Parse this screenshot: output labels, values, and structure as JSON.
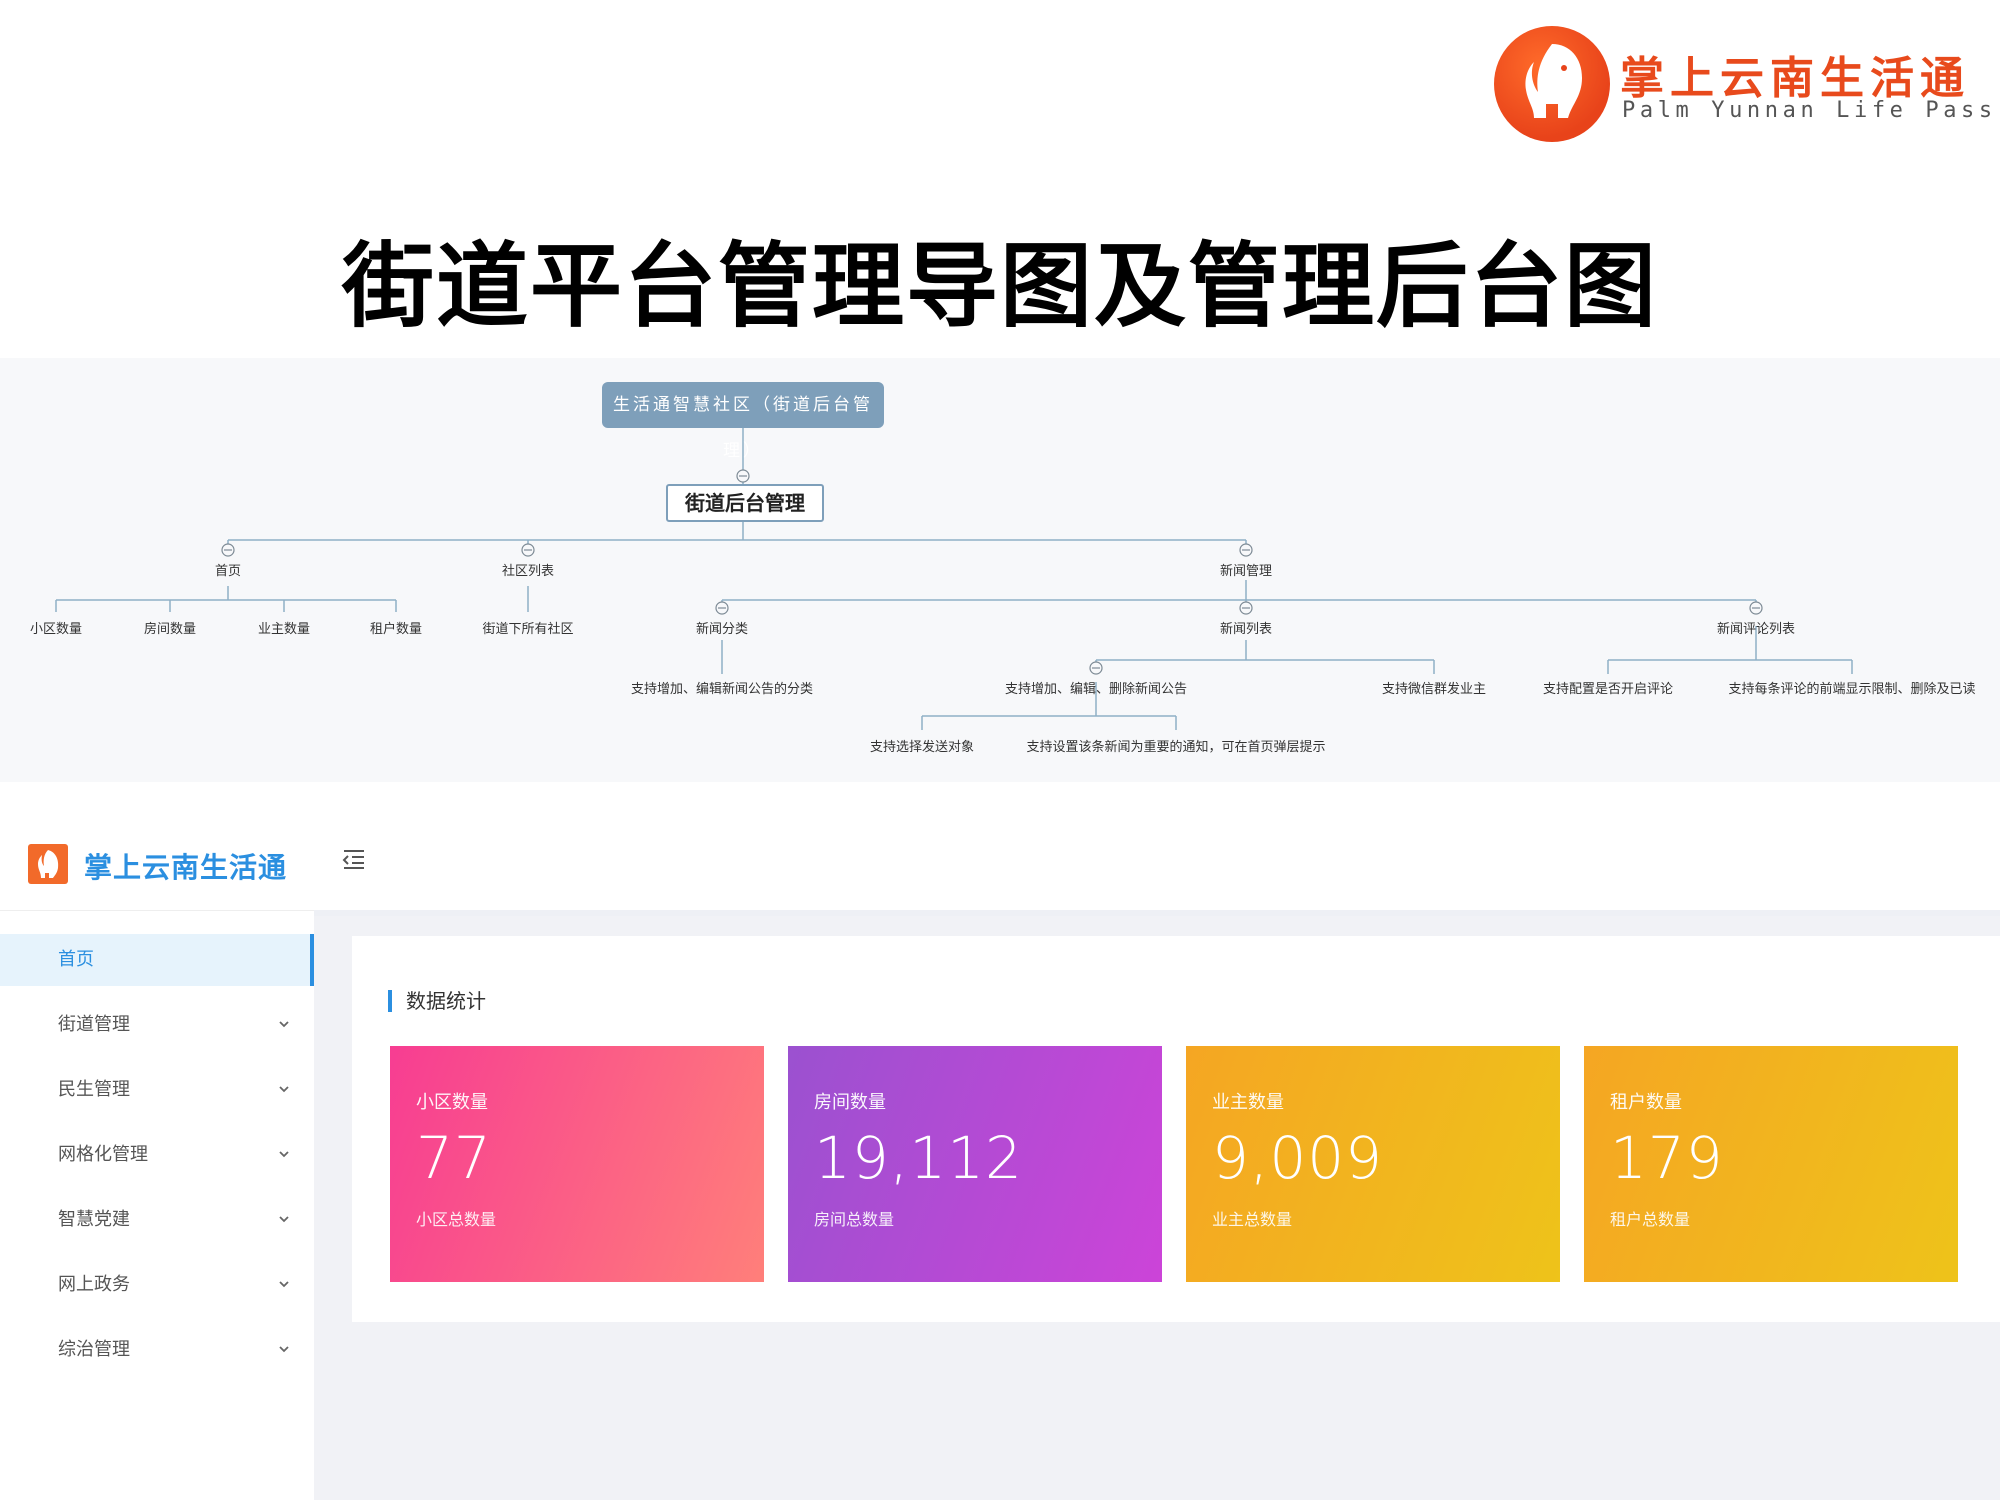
{
  "brand": {
    "name_cn": "掌上云南生活通",
    "name_en": "Palm Yunnan Life Pass",
    "color": "#e84a1c"
  },
  "slide": {
    "title": "街道平台管理导图及管理后台图"
  },
  "mindmap": {
    "root": "生活通智慧社区（街道后台管理）",
    "admin": "街道后台管理",
    "level1": [
      "首页",
      "社区列表",
      "新闻管理"
    ],
    "home_children": [
      "小区数量",
      "房间数量",
      "业主数量",
      "租户数量"
    ],
    "community_children": [
      "街道下所有社区"
    ],
    "news_children": [
      "新闻分类",
      "新闻列表",
      "新闻评论列表"
    ],
    "category_children": [
      "支持增加、编辑新闻公告的分类"
    ],
    "list_children": [
      "支持增加、编辑、删除新闻公告",
      "支持微信群发业主"
    ],
    "list_sub_children": [
      "支持选择发送对象",
      "支持设置该条新闻为重要的通知，可在首页弹层提示"
    ],
    "comment_children": [
      "支持配置是否开启评论",
      "支持每条评论的前端显示限制、删除及已读"
    ]
  },
  "admin": {
    "app_title": "掌上云南生活通",
    "accent": "#2b8fe0",
    "menu": [
      {
        "label": "首页",
        "active": true
      },
      {
        "label": "街道管理"
      },
      {
        "label": "民生管理"
      },
      {
        "label": "网格化管理"
      },
      {
        "label": "智慧党建"
      },
      {
        "label": "网上政务"
      },
      {
        "label": "综治管理"
      }
    ],
    "section_title": "数据统计",
    "cards": [
      {
        "label": "小区数量",
        "value": "77",
        "sub": "小区总数量"
      },
      {
        "label": "房间数量",
        "value": "19,112",
        "sub": "房间总数量"
      },
      {
        "label": "业主数量",
        "value": "9,009",
        "sub": "业主总数量"
      },
      {
        "label": "租户数量",
        "value": "179",
        "sub": "租户总数量"
      }
    ]
  }
}
